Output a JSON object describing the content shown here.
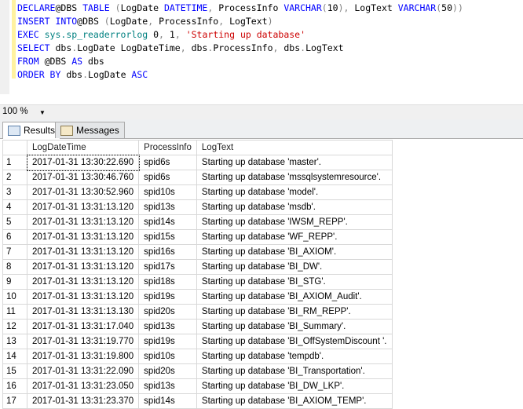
{
  "editor": {
    "lines": [
      [
        [
          "kw",
          "DECLARE"
        ],
        [
          "",
          "@DBS "
        ],
        [
          "kw",
          "TABLE"
        ],
        [
          "gr",
          " ("
        ],
        [
          "",
          "LogDate "
        ],
        [
          "kw",
          "DATETIME"
        ],
        [
          "gr",
          ", "
        ],
        [
          "",
          "ProcessInfo "
        ],
        [
          "kw",
          "VARCHAR"
        ],
        [
          "gr",
          "("
        ],
        [
          "",
          "10"
        ],
        [
          "gr",
          "), "
        ],
        [
          "",
          "LogText "
        ],
        [
          "kw",
          "VARCHAR"
        ],
        [
          "gr",
          "("
        ],
        [
          "",
          "50"
        ],
        [
          "gr",
          "))"
        ]
      ],
      [
        [
          "kw",
          "INSERT INTO"
        ],
        [
          "",
          "@DBS "
        ],
        [
          "gr",
          "("
        ],
        [
          "",
          "LogDate"
        ],
        [
          "gr",
          ", "
        ],
        [
          "",
          "ProcessInfo"
        ],
        [
          "gr",
          ", "
        ],
        [
          "",
          "LogText"
        ],
        [
          "gr",
          ")"
        ]
      ],
      [
        [
          "kw",
          "EXEC "
        ],
        [
          "fn",
          "sys.sp_readerrorlog "
        ],
        [
          "",
          "0"
        ],
        [
          "gr",
          ", "
        ],
        [
          "",
          "1"
        ],
        [
          "gr",
          ", "
        ],
        [
          "str",
          "'Starting up database'"
        ]
      ],
      [
        [
          "kw",
          "SELECT "
        ],
        [
          "",
          "dbs"
        ],
        [
          "gr",
          "."
        ],
        [
          "",
          "LogDate LogDateTime"
        ],
        [
          "gr",
          ", "
        ],
        [
          "",
          "dbs"
        ],
        [
          "gr",
          "."
        ],
        [
          "",
          "ProcessInfo"
        ],
        [
          "gr",
          ", "
        ],
        [
          "",
          "dbs"
        ],
        [
          "gr",
          "."
        ],
        [
          "",
          "LogText"
        ]
      ],
      [
        [
          "kw",
          "FROM "
        ],
        [
          "",
          "@DBS "
        ],
        [
          "kw",
          "AS "
        ],
        [
          "",
          "dbs"
        ]
      ],
      [
        [
          "kw",
          "ORDER BY "
        ],
        [
          "",
          "dbs"
        ],
        [
          "gr",
          "."
        ],
        [
          "",
          "LogDate "
        ],
        [
          "kw",
          "ASC"
        ]
      ]
    ]
  },
  "zoom": {
    "value": "100 %"
  },
  "tabs": [
    {
      "label": "Results",
      "icon": "grid-icon"
    },
    {
      "label": "Messages",
      "icon": "messages-icon"
    }
  ],
  "grid": {
    "columns": [
      "LogDateTime",
      "ProcessInfo",
      "LogText"
    ],
    "rows": [
      [
        "1",
        "2017-01-31 13:30:22.690",
        "spid6s",
        "Starting up database 'master'."
      ],
      [
        "2",
        "2017-01-31 13:30:46.760",
        "spid6s",
        "Starting up database 'mssqlsystemresource'."
      ],
      [
        "3",
        "2017-01-31 13:30:52.960",
        "spid10s",
        "Starting up database 'model'."
      ],
      [
        "4",
        "2017-01-31 13:31:13.120",
        "spid13s",
        "Starting up database 'msdb'."
      ],
      [
        "5",
        "2017-01-31 13:31:13.120",
        "spid14s",
        "Starting up database 'IWSM_REPP'."
      ],
      [
        "6",
        "2017-01-31 13:31:13.120",
        "spid15s",
        "Starting up database 'WF_REPP'."
      ],
      [
        "7",
        "2017-01-31 13:31:13.120",
        "spid16s",
        "Starting up database 'BI_AXIOM'."
      ],
      [
        "8",
        "2017-01-31 13:31:13.120",
        "spid17s",
        "Starting up database 'BI_DW'."
      ],
      [
        "9",
        "2017-01-31 13:31:13.120",
        "spid18s",
        "Starting up database 'BI_STG'."
      ],
      [
        "10",
        "2017-01-31 13:31:13.120",
        "spid19s",
        "Starting up database 'BI_AXIOM_Audit'."
      ],
      [
        "11",
        "2017-01-31 13:31:13.130",
        "spid20s",
        "Starting up database 'BI_RM_REPP'."
      ],
      [
        "12",
        "2017-01-31 13:31:17.040",
        "spid13s",
        "Starting up database 'BI_Summary'."
      ],
      [
        "13",
        "2017-01-31 13:31:19.770",
        "spid19s",
        "Starting up database 'BI_OffSystemDiscount '."
      ],
      [
        "14",
        "2017-01-31 13:31:19.800",
        "spid10s",
        "Starting up database 'tempdb'."
      ],
      [
        "15",
        "2017-01-31 13:31:22.090",
        "spid20s",
        "Starting up database 'BI_Transportation'."
      ],
      [
        "16",
        "2017-01-31 13:31:23.050",
        "spid13s",
        "Starting up database 'BI_DW_LKP'."
      ],
      [
        "17",
        "2017-01-31 13:31:23.370",
        "spid14s",
        "Starting up database 'BI_AXIOM_TEMP'."
      ]
    ]
  }
}
